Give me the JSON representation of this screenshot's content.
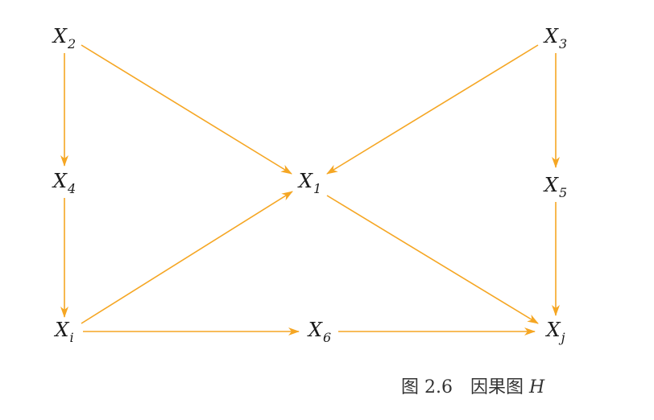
{
  "diagram": {
    "edge_color": "#F5A623",
    "nodes": [
      {
        "id": "X2",
        "base": "X",
        "sub": "2"
      },
      {
        "id": "X3",
        "base": "X",
        "sub": "3"
      },
      {
        "id": "X4",
        "base": "X",
        "sub": "4"
      },
      {
        "id": "X1",
        "base": "X",
        "sub": "1"
      },
      {
        "id": "X5",
        "base": "X",
        "sub": "5"
      },
      {
        "id": "Xi",
        "base": "X",
        "sub": "i"
      },
      {
        "id": "X6",
        "base": "X",
        "sub": "6"
      },
      {
        "id": "Xj",
        "base": "X",
        "sub": "j"
      }
    ],
    "edges": [
      {
        "from": "X2",
        "to": "X4"
      },
      {
        "from": "X2",
        "to": "X1"
      },
      {
        "from": "X3",
        "to": "X1"
      },
      {
        "from": "X3",
        "to": "X5"
      },
      {
        "from": "X4",
        "to": "Xi"
      },
      {
        "from": "Xi",
        "to": "X1"
      },
      {
        "from": "Xi",
        "to": "X6"
      },
      {
        "from": "X6",
        "to": "Xj"
      },
      {
        "from": "X1",
        "to": "Xj"
      },
      {
        "from": "X5",
        "to": "Xj"
      }
    ]
  },
  "caption": {
    "prefix": "图 2.6　因果图 ",
    "italic": "H"
  }
}
